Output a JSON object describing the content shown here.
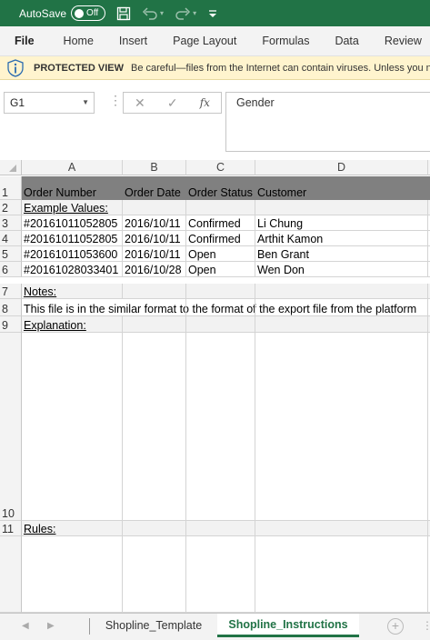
{
  "titlebar": {
    "autosave_label": "AutoSave",
    "autosave_state": "Off",
    "icons": [
      "save-icon",
      "undo-icon",
      "redo-icon",
      "customize-quick-access-icon"
    ],
    "bg_color": "#217346"
  },
  "ribbon": {
    "tabs": [
      "File",
      "Home",
      "Insert",
      "Page Layout",
      "Formulas",
      "Data",
      "Review"
    ],
    "active_tab": "File"
  },
  "protected_view": {
    "title": "PROTECTED VIEW",
    "message": "Be careful—files from the Internet can contain viruses. Unless you need to edit, it's safer to stay in Protected View.",
    "bg_color": "#fff4ce"
  },
  "formula_bar": {
    "name_box": "G1",
    "content": "Gender",
    "fx_label": "fx"
  },
  "grid": {
    "columns": [
      "A",
      "B",
      "C",
      "D"
    ],
    "rows": [
      {
        "num": "1",
        "cells": [
          "Order Number",
          "Order Date",
          "Order Status",
          "Customer"
        ]
      },
      {
        "num": "2",
        "cells": [
          "Example Values:",
          "",
          "",
          ""
        ]
      },
      {
        "num": "3",
        "cells": [
          "#20161011052805",
          "2016/10/11",
          "Confirmed",
          "Li Chung"
        ]
      },
      {
        "num": "4",
        "cells": [
          "#20161011052805",
          "2016/10/11",
          "Confirmed",
          "Arthit Kamon"
        ]
      },
      {
        "num": "5",
        "cells": [
          "#20161011053600",
          "2016/10/11",
          "Open",
          "Ben Grant"
        ]
      },
      {
        "num": "6",
        "cells": [
          "#20161028033401",
          "2016/10/28",
          "Open",
          "Wen Don"
        ]
      },
      {
        "num": "7",
        "cells": [
          "Notes:",
          "",
          "",
          ""
        ]
      },
      {
        "num": "8",
        "cells": [
          "This file is in the similar format to the format of the export file from the platform",
          "",
          "",
          ""
        ]
      },
      {
        "num": "9",
        "cells": [
          "Explanation:",
          "",
          "",
          ""
        ]
      },
      {
        "num": "10",
        "cells": [
          "",
          "",
          "",
          ""
        ]
      },
      {
        "num": "11",
        "cells": [
          "Rules:",
          "",
          "",
          ""
        ]
      },
      {
        "num": "",
        "cells": [
          "",
          "",
          "",
          ""
        ]
      }
    ],
    "header_row_color": "#808080",
    "section_row_color": "#f2f2f2"
  },
  "sheet_tabs": {
    "tabs": [
      "Shopline_Template",
      "Shopline_Instructions"
    ],
    "active": "Shopline_Instructions",
    "accent_color": "#217346"
  }
}
